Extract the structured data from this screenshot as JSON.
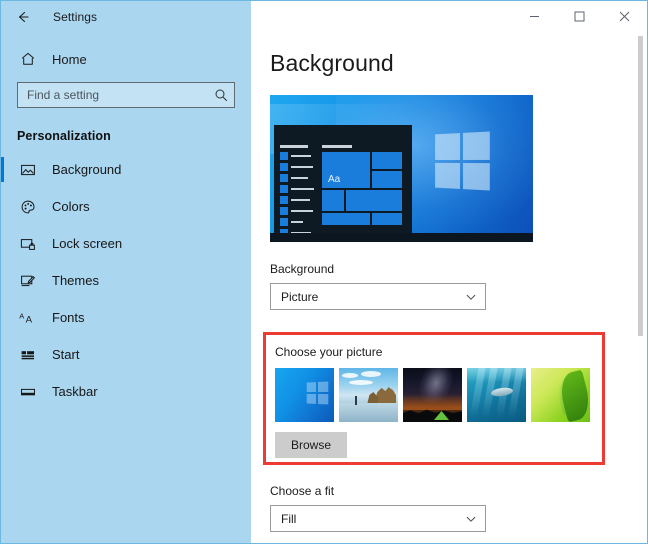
{
  "window": {
    "title": "Settings",
    "back_icon": "back-arrow-icon",
    "minimize_label": "–",
    "maximize_label": "□",
    "close_label": "✕"
  },
  "sidebar": {
    "home": {
      "label": "Home",
      "icon": "home-icon"
    },
    "search": {
      "placeholder": "Find a setting",
      "value": "",
      "icon": "search-icon"
    },
    "section_title": "Personalization",
    "items": [
      {
        "label": "Background",
        "icon": "image-icon",
        "selected": true
      },
      {
        "label": "Colors",
        "icon": "palette-icon",
        "selected": false
      },
      {
        "label": "Lock screen",
        "icon": "lock-screen-icon",
        "selected": false
      },
      {
        "label": "Themes",
        "icon": "themes-brush-icon",
        "selected": false
      },
      {
        "label": "Fonts",
        "icon": "fonts-aa-icon",
        "selected": false
      },
      {
        "label": "Start",
        "icon": "start-tiles-icon",
        "selected": false
      },
      {
        "label": "Taskbar",
        "icon": "taskbar-icon",
        "selected": false
      }
    ]
  },
  "main": {
    "page_title": "Background",
    "preview": {
      "alt": "desktop-preview",
      "tile_text": "Aa"
    },
    "background_field": {
      "label": "Background",
      "value": "Picture",
      "chevron": "chevron-down-icon"
    },
    "choose_picture": {
      "label": "Choose your picture",
      "highlighted": true,
      "highlight_color": "#ec3b33",
      "thumbnails": [
        {
          "name": "windows-hero-blue"
        },
        {
          "name": "beach-rock-formation"
        },
        {
          "name": "night-sky-camping-tent"
        },
        {
          "name": "underwater-ocean"
        },
        {
          "name": "green-leaf"
        }
      ],
      "browse_label": "Browse"
    },
    "fit_field": {
      "label": "Choose a fit",
      "value": "Fill",
      "chevron": "chevron-down-icon"
    }
  },
  "colors": {
    "sidebar_bg": "#aad6ef",
    "accent": "#0078d7",
    "highlight": "#ec3b33",
    "window_border": "#6cb8e0"
  }
}
